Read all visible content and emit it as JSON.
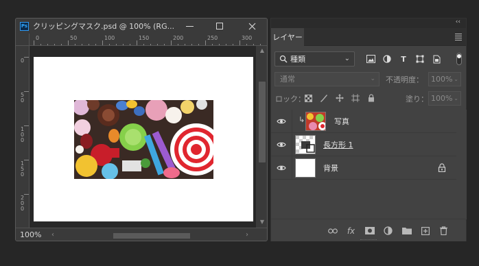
{
  "document": {
    "app_badge": "Ps",
    "title": "クリッピングマスク.psd @ 100% (RG...",
    "zoom_status": "100%",
    "ruler_h_labels": [
      "0",
      "50",
      "100",
      "150",
      "200",
      "250",
      "300"
    ],
    "ruler_v_labels": [
      "0",
      "5 0",
      "1 0 0",
      "1 5 0",
      "2 0 0"
    ]
  },
  "panel": {
    "collapse": "‹‹",
    "tab_label": "レイヤー",
    "filter_kind": "種類",
    "blend_mode": "通常",
    "opacity_label": "不透明度：",
    "opacity_value": "100%",
    "lock_label": "ロック：",
    "fill_label": "塗り：",
    "fill_value": "100%",
    "layers": [
      {
        "name": "写真",
        "clipped": true,
        "visible": true
      },
      {
        "name": "長方形 1",
        "clipped": false,
        "visible": true
      },
      {
        "name": "背景",
        "clipped": false,
        "visible": true,
        "locked": true
      }
    ]
  },
  "colors": {
    "app_bg": "#262626",
    "panel_bg": "#424242",
    "ps_blue": "#31a8ff"
  }
}
